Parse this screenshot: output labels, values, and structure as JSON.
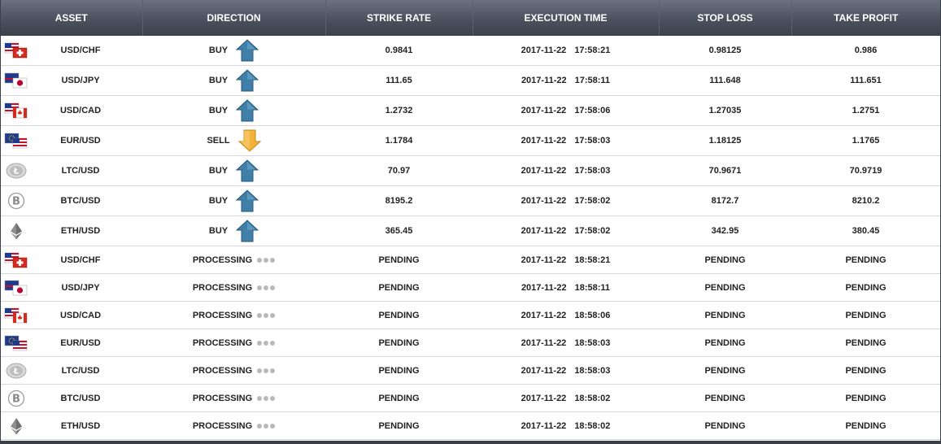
{
  "header": {
    "columns": [
      "ASSET",
      "DIRECTION",
      "STRIKE RATE",
      "EXECUTION TIME",
      "STOP LOSS",
      "TAKE PROFIT"
    ]
  },
  "colors": {
    "header_bg": "#4b515d",
    "buy_arrow": "#3f7fa8",
    "sell_arrow": "#f2b23a",
    "dot": "#b9b9b9"
  },
  "rows": [
    {
      "asset": "USD/CHF",
      "icon": "usd-chf-flag-icon",
      "direction": "BUY",
      "arrow": "up",
      "strike": "0.9841",
      "date": "2017-11-22",
      "time": "17:58:21",
      "stop_loss": "0.98125",
      "take_profit": "0.986"
    },
    {
      "asset": "USD/JPY",
      "icon": "usd-jpy-flag-icon",
      "direction": "BUY",
      "arrow": "up",
      "strike": "111.65",
      "date": "2017-11-22",
      "time": "17:58:11",
      "stop_loss": "111.648",
      "take_profit": "111.651"
    },
    {
      "asset": "USD/CAD",
      "icon": "usd-cad-flag-icon",
      "direction": "BUY",
      "arrow": "up",
      "strike": "1.2732",
      "date": "2017-11-22",
      "time": "17:58:06",
      "stop_loss": "1.27035",
      "take_profit": "1.2751"
    },
    {
      "asset": "EUR/USD",
      "icon": "eur-usd-flag-icon",
      "direction": "SELL",
      "arrow": "down",
      "strike": "1.1784",
      "date": "2017-11-22",
      "time": "17:58:03",
      "stop_loss": "1.18125",
      "take_profit": "1.1765"
    },
    {
      "asset": "LTC/USD",
      "icon": "litecoin-icon",
      "direction": "BUY",
      "arrow": "up",
      "strike": "70.97",
      "date": "2017-11-22",
      "time": "17:58:03",
      "stop_loss": "70.9671",
      "take_profit": "70.9719"
    },
    {
      "asset": "BTC/USD",
      "icon": "bitcoin-icon",
      "direction": "BUY",
      "arrow": "up",
      "strike": "8195.2",
      "date": "2017-11-22",
      "time": "17:58:02",
      "stop_loss": "8172.7",
      "take_profit": "8210.2"
    },
    {
      "asset": "ETH/USD",
      "icon": "ethereum-icon",
      "direction": "BUY",
      "arrow": "up",
      "strike": "365.45",
      "date": "2017-11-22",
      "time": "17:58:02",
      "stop_loss": "342.95",
      "take_profit": "380.45"
    }
  ],
  "pending_rows": [
    {
      "asset": "USD/CHF",
      "icon": "usd-chf-flag-icon",
      "direction": "PROCESSING",
      "strike": "PENDING",
      "date": "2017-11-22",
      "time": "18:58:21",
      "stop_loss": "PENDING",
      "take_profit": "PENDING"
    },
    {
      "asset": "USD/JPY",
      "icon": "usd-jpy-flag-icon",
      "direction": "PROCESSING",
      "strike": "PENDING",
      "date": "2017-11-22",
      "time": "18:58:11",
      "stop_loss": "PENDING",
      "take_profit": "PENDING"
    },
    {
      "asset": "USD/CAD",
      "icon": "usd-cad-flag-icon",
      "direction": "PROCESSING",
      "strike": "PENDING",
      "date": "2017-11-22",
      "time": "18:58:06",
      "stop_loss": "PENDING",
      "take_profit": "PENDING"
    },
    {
      "asset": "EUR/USD",
      "icon": "eur-usd-flag-icon",
      "direction": "PROCESSING",
      "strike": "PENDING",
      "date": "2017-11-22",
      "time": "18:58:03",
      "stop_loss": "PENDING",
      "take_profit": "PENDING"
    },
    {
      "asset": "LTC/USD",
      "icon": "litecoin-icon",
      "direction": "PROCESSING",
      "strike": "PENDING",
      "date": "2017-11-22",
      "time": "18:58:03",
      "stop_loss": "PENDING",
      "take_profit": "PENDING"
    },
    {
      "asset": "BTC/USD",
      "icon": "bitcoin-icon",
      "direction": "PROCESSING",
      "strike": "PENDING",
      "date": "2017-11-22",
      "time": "18:58:02",
      "stop_loss": "PENDING",
      "take_profit": "PENDING"
    },
    {
      "asset": "ETH/USD",
      "icon": "ethereum-icon",
      "direction": "PROCESSING",
      "strike": "PENDING",
      "date": "2017-11-22",
      "time": "18:58:02",
      "stop_loss": "PENDING",
      "take_profit": "PENDING"
    }
  ]
}
